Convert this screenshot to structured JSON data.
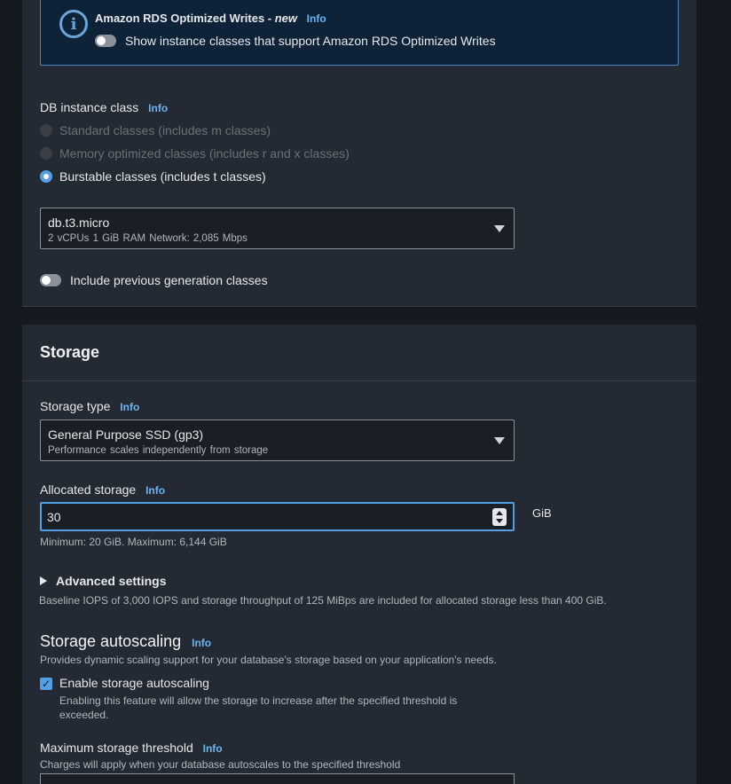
{
  "alert": {
    "title": "Amazon RDS Optimized Writes - ",
    "title_new": "new",
    "info": "Info",
    "toggle_label": "Show instance classes that support Amazon RDS Optimized Writes"
  },
  "db_instance_class": {
    "label": "DB instance class",
    "info": "Info",
    "options": [
      {
        "label": "Standard classes (includes m classes)",
        "state": "disabled"
      },
      {
        "label": "Memory optimized classes (includes r and x classes)",
        "state": "disabled"
      },
      {
        "label": "Burstable classes (includes t classes)",
        "state": "selected"
      }
    ],
    "selected_class": "db.t3.micro",
    "selected_details": "2 vCPUs   1 GiB RAM   Network: 2,085 Mbps",
    "previous_gen_label": "Include previous generation classes"
  },
  "storage": {
    "title": "Storage",
    "storage_type_label": "Storage type",
    "info": "Info",
    "storage_type_value": "General Purpose SSD (gp3)",
    "storage_type_desc": "Performance scales independently from storage",
    "allocated_label": "Allocated storage",
    "allocated_value": "30",
    "allocated_unit": "GiB",
    "allocated_hint": "Minimum: 20 GiB. Maximum: 6,144 GiB",
    "advanced_label": "Advanced settings",
    "baseline_note": "Baseline IOPS of 3,000 IOPS and storage throughput of 125 MiBps are included for allocated storage less than 400 GiB."
  },
  "autoscaling": {
    "title": "Storage autoscaling",
    "info": "Info",
    "desc": "Provides dynamic scaling support for your database's storage based on your application's needs.",
    "enable_label": "Enable storage autoscaling",
    "enable_desc": "Enabling this feature will allow the storage to increase after the specified threshold is exceeded.",
    "threshold_label": "Maximum storage threshold",
    "threshold_desc": "Charges will apply when your database autoscales to the specified threshold"
  },
  "colors": {
    "accent": "#539fe5",
    "info_link": "#6db3f2",
    "panel": "#232a33",
    "alert_bg": "#0e2337"
  }
}
